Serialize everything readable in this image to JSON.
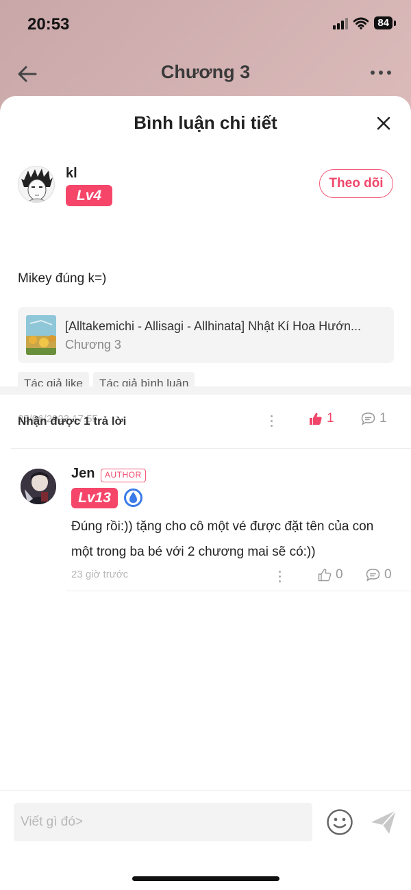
{
  "status_bar": {
    "time": "20:53",
    "battery": "84"
  },
  "nav": {
    "title": "Chương 3"
  },
  "sheet": {
    "title": "Bình luận chi tiết"
  },
  "comment": {
    "user_name": "kl",
    "level": "Lv4",
    "follow_label": "Theo dõi",
    "text": "Mikey đúng k=)",
    "book": {
      "title": "[Alltakemichi - Allisagi - Allhinata] Nhật Kí Hoa Hướn...",
      "chapter": "Chương 3"
    },
    "tags": [
      "Tác giả like",
      "Tác giả bình luận"
    ],
    "timestamp": "25/06/2023 17:55",
    "likes": "1",
    "replies": "1"
  },
  "replies_header": "Nhận được 1 trả lời",
  "reply": {
    "user_name": "Jen",
    "author_tag": "AUTHOR",
    "level": "Lv13",
    "text": "Đúng rồi:)) tặng cho cô một vé được đặt tên của con một trong ba bé với 2 chương mai sẽ có:))",
    "time": "23 giờ trước",
    "likes": "0",
    "replies": "0"
  },
  "composer": {
    "placeholder": "Viết gì đó>"
  },
  "colors": {
    "accent": "#f0466a",
    "background_gradient": "#d9b8b8"
  }
}
